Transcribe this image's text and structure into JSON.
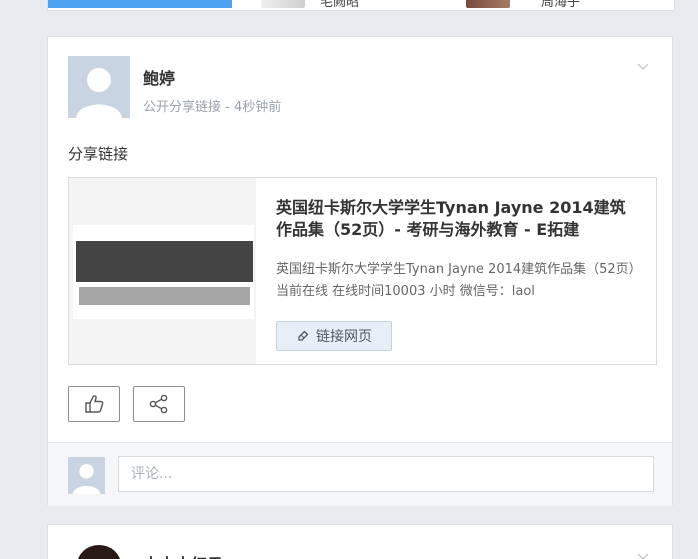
{
  "top_card": {
    "item1_label": "毛阙昭",
    "item2_label": "周海子"
  },
  "post": {
    "author": "鲍婷",
    "meta": "公开分享链接 - 4秒钟前",
    "text": "分享链接",
    "link": {
      "title": "英国纽卡斯尔大学学生Tynan Jayne 2014建筑作品集（52页）- 考研与海外教育 - E拓建",
      "description": "英国纽卡斯尔大学学生Tynan Jayne 2014建筑作品集（52页）当前在线 在线时间10003 小时 微信号：laol",
      "button_label": "链接网页"
    },
    "comment_placeholder": "评论..."
  },
  "next_post": {
    "author": "土土土红日"
  },
  "colors": {
    "background": "#e9ebee",
    "accent_blue": "#4da3f2",
    "card_border": "#dcdfe3"
  },
  "icons": [
    "chevron-down-icon",
    "link-icon",
    "thumbs-up-icon",
    "share-icon",
    "default-avatar-icon"
  ]
}
